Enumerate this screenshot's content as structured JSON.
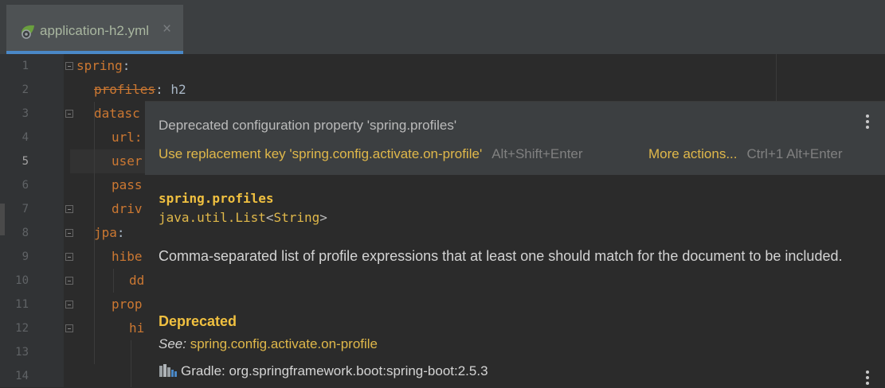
{
  "tab": {
    "label": "application-h2.yml",
    "close": "×"
  },
  "gutter": {
    "lines": [
      "1",
      "2",
      "3",
      "4",
      "5",
      "6",
      "7",
      "8",
      "9",
      "10",
      "11",
      "12",
      "13",
      "14"
    ],
    "active_line": "5"
  },
  "code": {
    "l1_key": "spring",
    "l1_colon": ":",
    "l2_key": "profiles",
    "l2_rest": ": h2",
    "l3_key": "datasc",
    "l4_key": "url:",
    "l5_key": "user",
    "l6_key": "pass",
    "l7_key": "driv",
    "l8_key": "jpa",
    "l8_colon": ":",
    "l9_key": "hibe",
    "l10_key": "dd",
    "l11_key": "prop",
    "l12_key": "hi"
  },
  "popup": {
    "title": "Deprecated configuration property 'spring.profiles'",
    "fix_label": "Use replacement key 'spring.config.activate.on-profile'",
    "fix_shortcut": "Alt+Shift+Enter",
    "more_label": "More actions...",
    "more_shortcut": "Ctrl+1 Alt+Enter",
    "sig_name": "spring.profiles",
    "sig_type_a": "java.util.List",
    "sig_lt": "<",
    "sig_type_b": "String",
    "sig_gt": ">",
    "description": "Comma-separated list of profile expressions that at least one should match for the document to be included.",
    "deprecated_heading": "Deprecated",
    "see_label": "See:",
    "see_link": "spring.config.activate.on-profile",
    "library": "Gradle: org.springframework.boot:spring-boot:2.5.3"
  },
  "colors": {
    "accent": "#4a88c7",
    "keyword": "#cc7832",
    "link": "#e0b84a",
    "heading": "#f0c040"
  },
  "icons": [
    "spring-leaf-icon",
    "menu-dots-icon",
    "library-icon",
    "fold-icon"
  ]
}
